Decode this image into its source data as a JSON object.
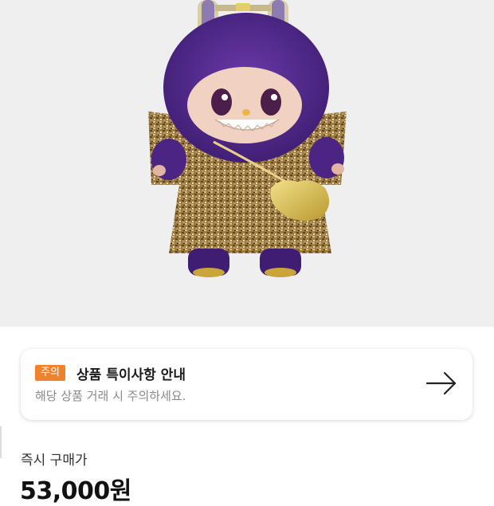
{
  "product": {
    "image_alt": "purple furry doll in gold tweed outfit"
  },
  "notice": {
    "badge": "주의",
    "title": "상품 특이사항 안내",
    "description": "해당 상품 거래 시 주의하세요.",
    "arrow_icon": "arrow-right-icon",
    "badge_color": "#f0822a"
  },
  "price": {
    "label": "즉시 구매가",
    "value": "53,000원"
  }
}
